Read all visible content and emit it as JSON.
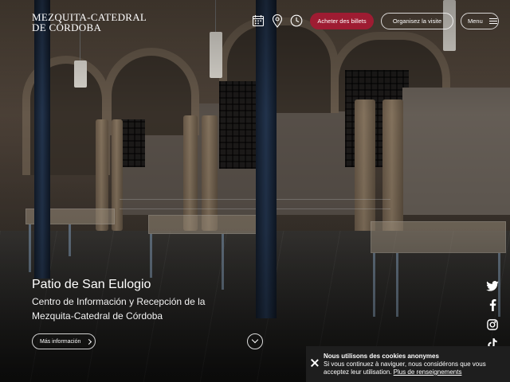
{
  "header": {
    "logo_line1": "MEZQUITA-CATEDRAL",
    "logo_line2": "DE CÓRDOBA",
    "icons": [
      "calendar-icon",
      "location-pin-icon",
      "clock-icon"
    ],
    "buy_tickets_label": "Acheter des billets",
    "organize_visit_label": "Organisez la visite",
    "menu_label": "Menu"
  },
  "hero": {
    "title": "Patio de San Eulogio",
    "subtitle": "Centro de Información y Recepción de la Mezquita-Catedral de Córdoba",
    "more_info_label": "Más información"
  },
  "social": [
    "twitter-icon",
    "facebook-icon",
    "instagram-icon",
    "tiktok-icon"
  ],
  "cookie": {
    "title": "Nous utilisons des cookies anonymes",
    "text": "Si vous continuez à naviguer, nous considérons que vous acceptez leur utilisation.",
    "link_label": "Plus de renseignements"
  },
  "colors": {
    "accent": "#9e1c32",
    "cookie_bg": "#1e1e1e",
    "text": "#ffffff"
  }
}
